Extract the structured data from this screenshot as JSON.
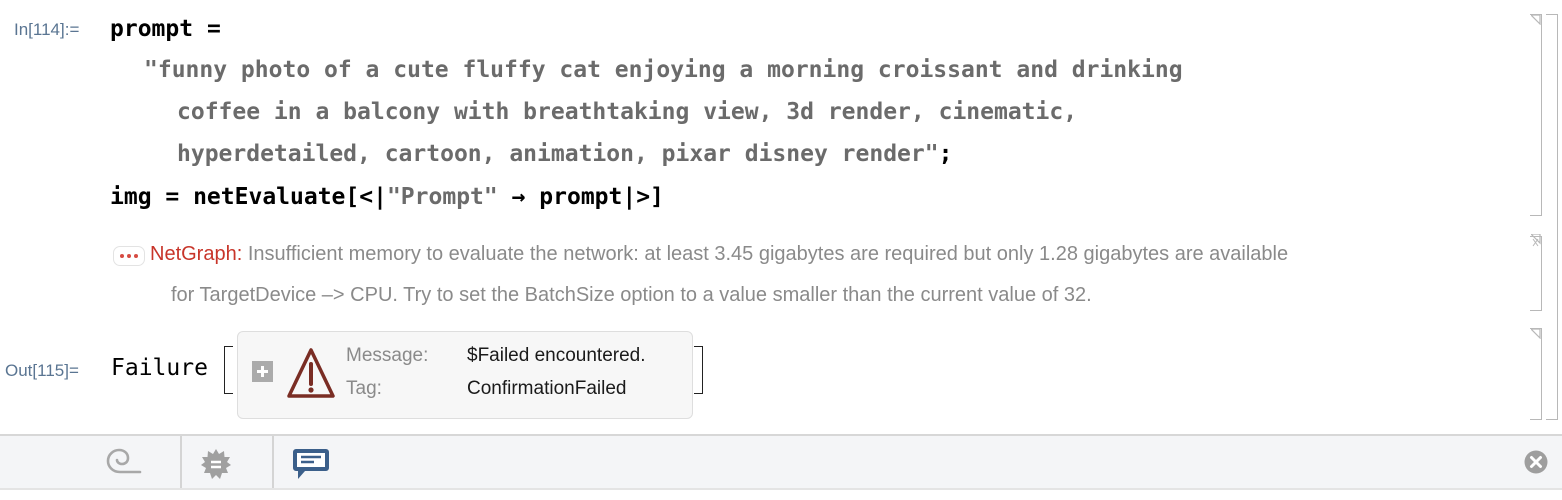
{
  "cells": {
    "input": {
      "label": "In[114]:=",
      "line1_var": "prompt",
      "line1_op": " =",
      "string_lines": [
        "\"funny photo of a cute fluffy cat enjoying a morning croissant and drinking",
        "coffee in a balcony with breathtaking view, 3d render, cinematic,",
        "hyperdetailed, cartoon, animation, pixar disney render\""
      ],
      "string_terminator": ";",
      "line4_pre": "img = netEvaluate[<|",
      "line4_key": "\"Prompt\"",
      "line4_post": " → prompt|>]"
    },
    "message": {
      "head": "NetGraph",
      "colon": ": ",
      "line1": "Insufficient memory to evaluate the network: at least 3.45 gigabytes are required but only 1.28 gigabytes are available",
      "line2": "for TargetDevice –> CPU. Try to set the BatchSize option to a value smaller than the current value of 32."
    },
    "output": {
      "label": "Out[115]=",
      "head": "Failure",
      "fields": [
        {
          "label": "Message:",
          "value": "$Failed encountered."
        },
        {
          "label": "Tag:",
          "value": "ConfirmationFailed"
        }
      ]
    }
  },
  "toolbar": {
    "icons": [
      "swirl-icon",
      "badge-icon",
      "chat-icon",
      "close-icon"
    ],
    "accent": "#3b5f8a"
  }
}
